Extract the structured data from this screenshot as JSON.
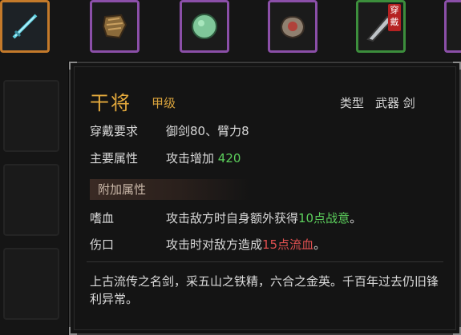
{
  "inventory": {
    "equip_tag": "穿戴",
    "colors": {
      "orange": "#c47a2a",
      "purple": "#8b4fa8",
      "green": "#3c8e3c"
    }
  },
  "tooltip": {
    "name": "干将",
    "grade": "甲级",
    "type_label": "类型",
    "type_value": "武器 剑",
    "requirement_label": "穿戴要求",
    "requirement_value": "御剑80、臂力8",
    "main_attr_label": "主要属性",
    "main_attr_text": "攻击增加",
    "main_attr_value": "420",
    "extra_header": "附加属性",
    "extra": [
      {
        "name": "嗜血",
        "text_a": "攻击敌方时自身额外获得",
        "highlight": "10点战意",
        "text_b": "。"
      },
      {
        "name": "伤口",
        "text_a": "攻击时对敌方造成",
        "highlight": "15点流血",
        "text_b": "。"
      }
    ],
    "description": "上古流传之名剑，采五山之铁精，六合之金英。千百年过去仍旧锋利异常。"
  }
}
